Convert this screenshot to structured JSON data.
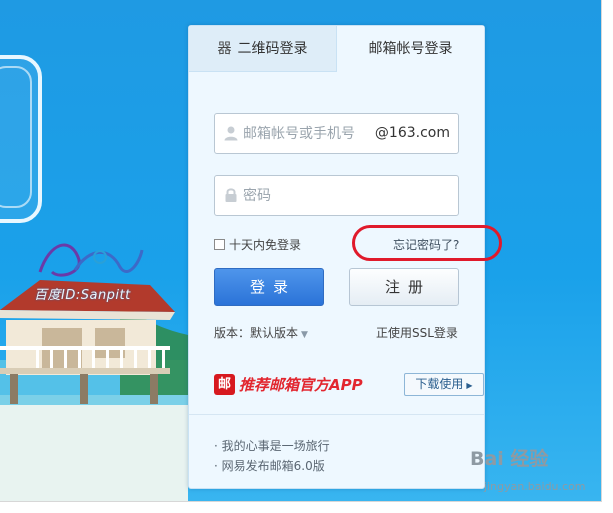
{
  "tabs": {
    "qr_icon": "器",
    "qr_label": "二维码登录",
    "mail_label": "邮箱帐号登录"
  },
  "account_field": {
    "placeholder": "邮箱帐号或手机号",
    "domain_suffix": "@163.com",
    "icon": "user-icon"
  },
  "password_field": {
    "placeholder": "密码",
    "icon": "lock-icon"
  },
  "remember_label": "十天内免登录",
  "forgot_link": "忘记密码了?",
  "login_button": "登录",
  "register_button": "注册",
  "version": {
    "label": "版本：默认版本",
    "caret": "▼"
  },
  "ssl_link": "正使用SSL登录",
  "app_promo": {
    "icon_char": "邮",
    "text": "推荐邮箱官方APP",
    "download_button": "下载使用",
    "arrow": "▶"
  },
  "news": [
    "· 我的心事是一场旅行",
    "· 网易发布邮箱6.0版"
  ],
  "watermark": {
    "text": "百度ID:Sanpitt"
  },
  "footer_watermark": {
    "brand": "Bai 经验",
    "url": "jingyan.baidu.com"
  },
  "colors": {
    "background": "#1aa1ea",
    "primary_button": "#2b73d8",
    "highlight_circle": "#e01a2b",
    "app_red": "#d7191f"
  }
}
